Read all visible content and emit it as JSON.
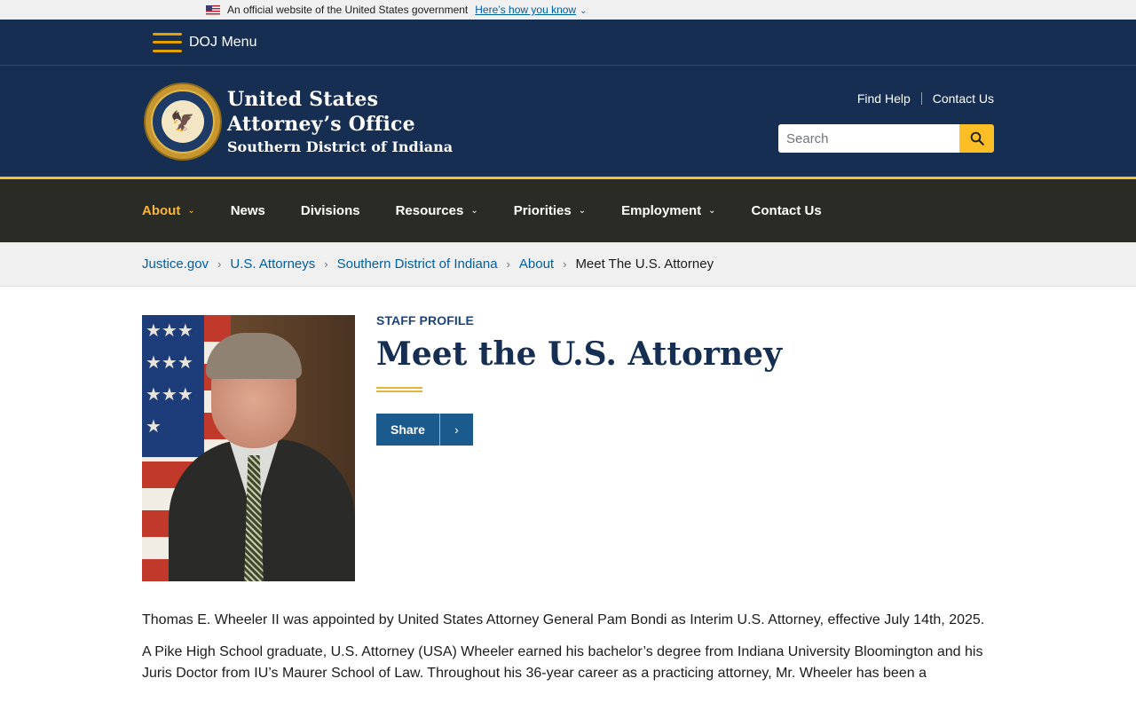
{
  "gov_banner": {
    "text": "An official website of the United States government",
    "link": "Here’s how you know"
  },
  "doj_menu": {
    "label": "DOJ Menu"
  },
  "header": {
    "office_line1": "United States",
    "office_line2": "Attorney’s Office",
    "office_line3": "Southern District of Indiana",
    "find_help": "Find Help",
    "contact_us": "Contact Us",
    "search_placeholder": "Search"
  },
  "nav": {
    "items": [
      {
        "label": "About",
        "active": true,
        "has_dropdown": true
      },
      {
        "label": "News",
        "has_dropdown": false
      },
      {
        "label": "Divisions",
        "has_dropdown": false
      },
      {
        "label": "Resources",
        "has_dropdown": true
      },
      {
        "label": "Priorities",
        "has_dropdown": true
      },
      {
        "label": "Employment",
        "has_dropdown": true
      },
      {
        "label": "Contact Us",
        "has_dropdown": false
      }
    ]
  },
  "breadcrumb": {
    "items": [
      "Justice.gov",
      "U.S. Attorneys",
      "Southern District of Indiana",
      "About"
    ],
    "current": "Meet The U.S. Attorney"
  },
  "profile": {
    "eyebrow": "STAFF PROFILE",
    "title": "Meet the U.S. Attorney",
    "share_label": "Share"
  },
  "bio": {
    "p1": "Thomas E. Wheeler II was appointed by United States Attorney General Pam Bondi as Interim U.S. Attorney, effective July 14th, 2025.",
    "p2": "A Pike High School graduate, U.S. Attorney (USA) Wheeler earned his bachelor’s degree from Indiana University Bloomington and his Juris Doctor from IU’s Maurer School of Law. Throughout his 36-year career as a practicing attorney, Mr. Wheeler has been a"
  },
  "colors": {
    "navy": "#162e51",
    "gold": "#fbbe25",
    "nav_bg": "#2b2b25",
    "link": "#005ea2"
  }
}
